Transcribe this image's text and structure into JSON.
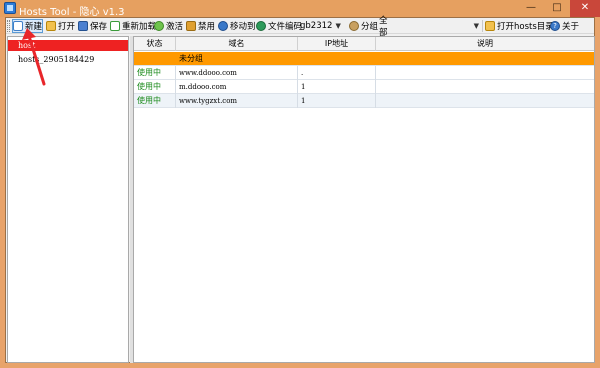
{
  "window": {
    "title": "Hosts Tool - 隐心 v1.3",
    "controls": {
      "minimize": "—",
      "maximize": "□",
      "close": "✕"
    },
    "frame_color": "#e6a060"
  },
  "toolbar": {
    "new_label": "新建",
    "open_label": "打开",
    "save_label": "保存",
    "reload_label": "重新加载",
    "activate_label": "激活",
    "disable_label": "禁用",
    "move_label": "移动到",
    "encoding_label": "文件编码",
    "encoding_value": "gb2312",
    "group_label": "分组",
    "group_value": "全部",
    "open_dir_label": "打开hosts目录",
    "about_label": "关于"
  },
  "sidebar": {
    "items": [
      {
        "label": "host"
      },
      {
        "label": "hosts_2905184429"
      }
    ]
  },
  "table": {
    "columns": [
      "状态",
      "域名",
      "IP地址",
      "说明"
    ],
    "group_row": {
      "label": "未分组",
      "color": "#ff9900"
    },
    "rows": [
      {
        "status": "使用中",
        "domain": "www.ddooo.com",
        "ip": ".",
        "note": ""
      },
      {
        "status": "使用中",
        "domain": "m.ddooo.com",
        "ip": "1",
        "note": ""
      },
      {
        "status": "使用中",
        "domain": "www.tygzxt.com",
        "ip": "1",
        "note": ""
      }
    ],
    "status_color": "#1a8a1a"
  },
  "annotation": {
    "arrow_color": "#e8262a"
  }
}
